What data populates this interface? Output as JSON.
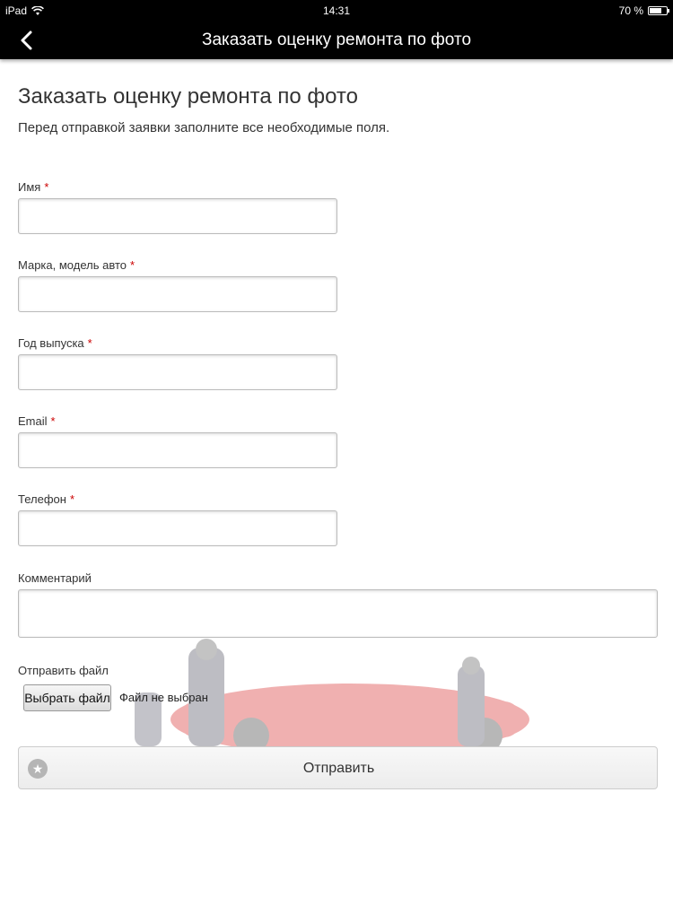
{
  "status_bar": {
    "device": "iPad",
    "time": "14:31",
    "battery": "70 %",
    "battery_level": 0.7,
    "wifi_icon": "wifi-icon"
  },
  "navbar": {
    "back_icon": "chevron-left-icon",
    "title": "Заказать оценку ремонта по фото"
  },
  "form": {
    "heading": "Заказать оценку ремонта по фото",
    "subtitle": "Перед отправкой заявки заполните все необходимые поля.",
    "required_mark": "*",
    "fields": [
      {
        "label": "Имя",
        "value": "",
        "required": true
      },
      {
        "label": "Марка, модель авто",
        "value": "",
        "required": true
      },
      {
        "label": "Год выпуска",
        "value": "",
        "required": true
      },
      {
        "label": "Email",
        "value": "",
        "required": true
      },
      {
        "label": "Телефон",
        "value": "",
        "required": true
      },
      {
        "label": "Комментарий",
        "value": "",
        "required": false
      }
    ],
    "file": {
      "label": "Отправить файл",
      "button": "Выбрать файл",
      "status": "Файл не выбран"
    },
    "submit": {
      "label": "Отправить",
      "icon": "star-icon"
    }
  },
  "colors": {
    "bar": "#000000",
    "required": "#cc0000",
    "car": "#d62020"
  }
}
